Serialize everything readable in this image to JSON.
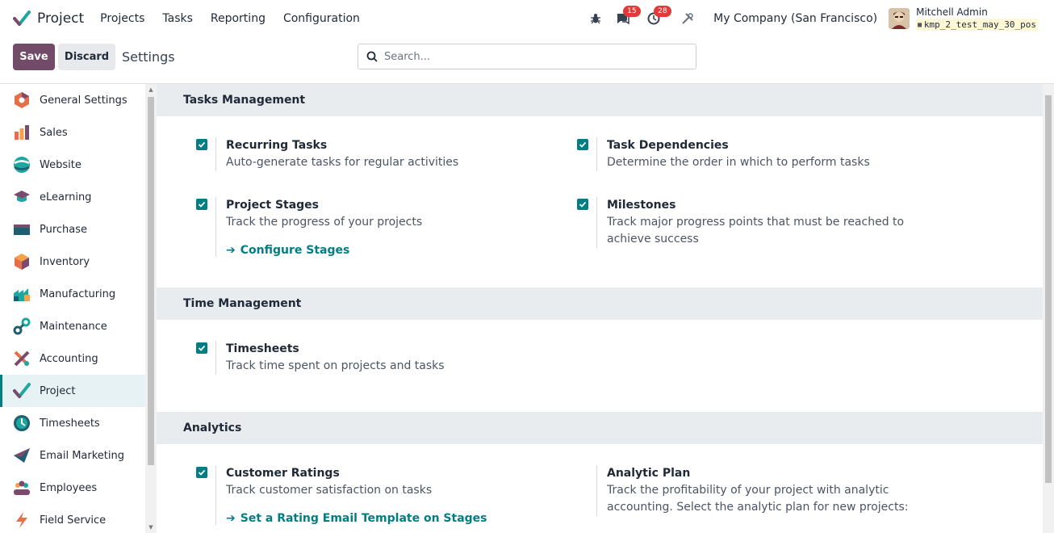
{
  "navbar": {
    "app_name": "Project",
    "menu": [
      "Projects",
      "Tasks",
      "Reporting",
      "Configuration"
    ],
    "messages_count": "15",
    "activities_count": "28",
    "company": "My Company (San Francisco)",
    "user_name": "Mitchell Admin",
    "database": "kmp_2_test_may_30_pos"
  },
  "control": {
    "save_label": "Save",
    "discard_label": "Discard",
    "title": "Settings",
    "search_placeholder": "Search..."
  },
  "sidebar": {
    "items": [
      {
        "label": "General Settings",
        "icon": "general-settings-icon",
        "active": false
      },
      {
        "label": "Sales",
        "icon": "sales-icon",
        "active": false
      },
      {
        "label": "Website",
        "icon": "website-icon",
        "active": false
      },
      {
        "label": "eLearning",
        "icon": "elearning-icon",
        "active": false
      },
      {
        "label": "Purchase",
        "icon": "purchase-icon",
        "active": false
      },
      {
        "label": "Inventory",
        "icon": "inventory-icon",
        "active": false
      },
      {
        "label": "Manufacturing",
        "icon": "manufacturing-icon",
        "active": false
      },
      {
        "label": "Maintenance",
        "icon": "maintenance-icon",
        "active": false
      },
      {
        "label": "Accounting",
        "icon": "accounting-icon",
        "active": false
      },
      {
        "label": "Project",
        "icon": "project-icon",
        "active": true
      },
      {
        "label": "Timesheets",
        "icon": "timesheets-icon",
        "active": false
      },
      {
        "label": "Email Marketing",
        "icon": "email-marketing-icon",
        "active": false
      },
      {
        "label": "Employees",
        "icon": "employees-icon",
        "active": false
      },
      {
        "label": "Field Service",
        "icon": "field-service-icon",
        "active": false
      }
    ]
  },
  "sections": {
    "tasks": {
      "title": "Tasks Management",
      "recurring": {
        "title": "Recurring Tasks",
        "desc": "Auto-generate tasks for regular activities",
        "checked": true
      },
      "dependencies": {
        "title": "Task Dependencies",
        "desc": "Determine the order in which to perform tasks",
        "checked": true
      },
      "stages": {
        "title": "Project Stages",
        "desc": "Track the progress of your projects",
        "link": "Configure Stages",
        "checked": true
      },
      "milestones": {
        "title": "Milestones",
        "desc": "Track major progress points that must be reached to achieve success",
        "checked": true
      }
    },
    "time": {
      "title": "Time Management",
      "timesheets": {
        "title": "Timesheets",
        "desc": "Track time spent on projects and tasks",
        "checked": true
      }
    },
    "analytics": {
      "title": "Analytics",
      "ratings": {
        "title": "Customer Ratings",
        "desc": "Track customer satisfaction on tasks",
        "link": "Set a Rating Email Template on Stages",
        "checked": true
      },
      "plan": {
        "title": "Analytic Plan",
        "desc": "Track the profitability of your project with analytic accounting. Select the analytic plan for new projects:"
      }
    }
  },
  "colors": {
    "primary": "#714b67",
    "accent": "#017e84",
    "badge": "#e03a3a"
  }
}
